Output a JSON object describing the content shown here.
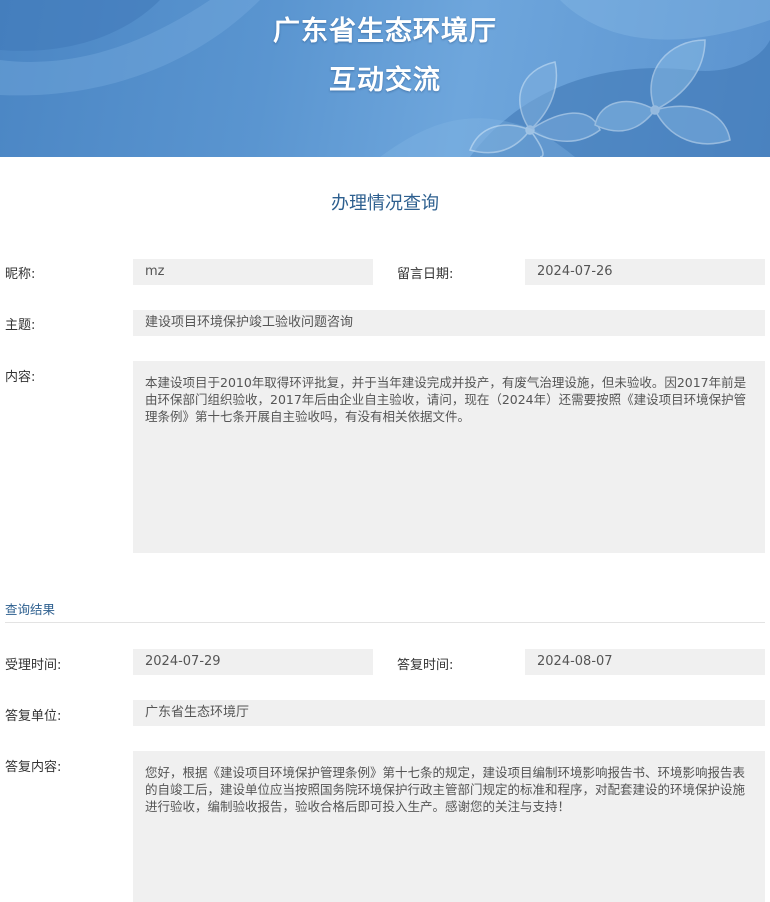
{
  "header": {
    "title_line1": "广东省生态环境厅",
    "title_line2": "互动交流"
  },
  "page": {
    "heading": "办理情况查询"
  },
  "inquiry": {
    "nickname_label": "昵称:",
    "nickname_value": "mz",
    "date_label": "留言日期:",
    "date_value": "2024-07-26",
    "subject_label": "主题:",
    "subject_value": "建设项目环境保护竣工验收问题咨询",
    "content_label": "内容:",
    "content_value": "本建设项目于2010年取得环评批复，并于当年建设完成并投产，有废气治理设施，但未验收。因2017年前是由环保部门组织验收，2017年后由企业自主验收，请问，现在（2024年）还需要按照《建设项目环境保护管理条例》第十七条开展自主验收吗，有没有相关依据文件。"
  },
  "result": {
    "section_title": "查询结果",
    "accept_time_label": "受理时间:",
    "accept_time_value": "2024-07-29",
    "reply_time_label": "答复时间:",
    "reply_time_value": "2024-08-07",
    "reply_unit_label": "答复单位:",
    "reply_unit_value": "广东省生态环境厅",
    "reply_content_label": "答复内容:",
    "reply_content_value": "您好，根据《建设项目环境保护管理条例》第十七条的规定，建设项目编制环境影响报告书、环境影响报告表的自竣工后，建设单位应当按照国务院环境保护行政主管部门规定的标准和程序，对配套建设的环境保护设施进行验收，编制验收报告，验收合格后即可投入生产。感谢您的关注与支持！"
  }
}
